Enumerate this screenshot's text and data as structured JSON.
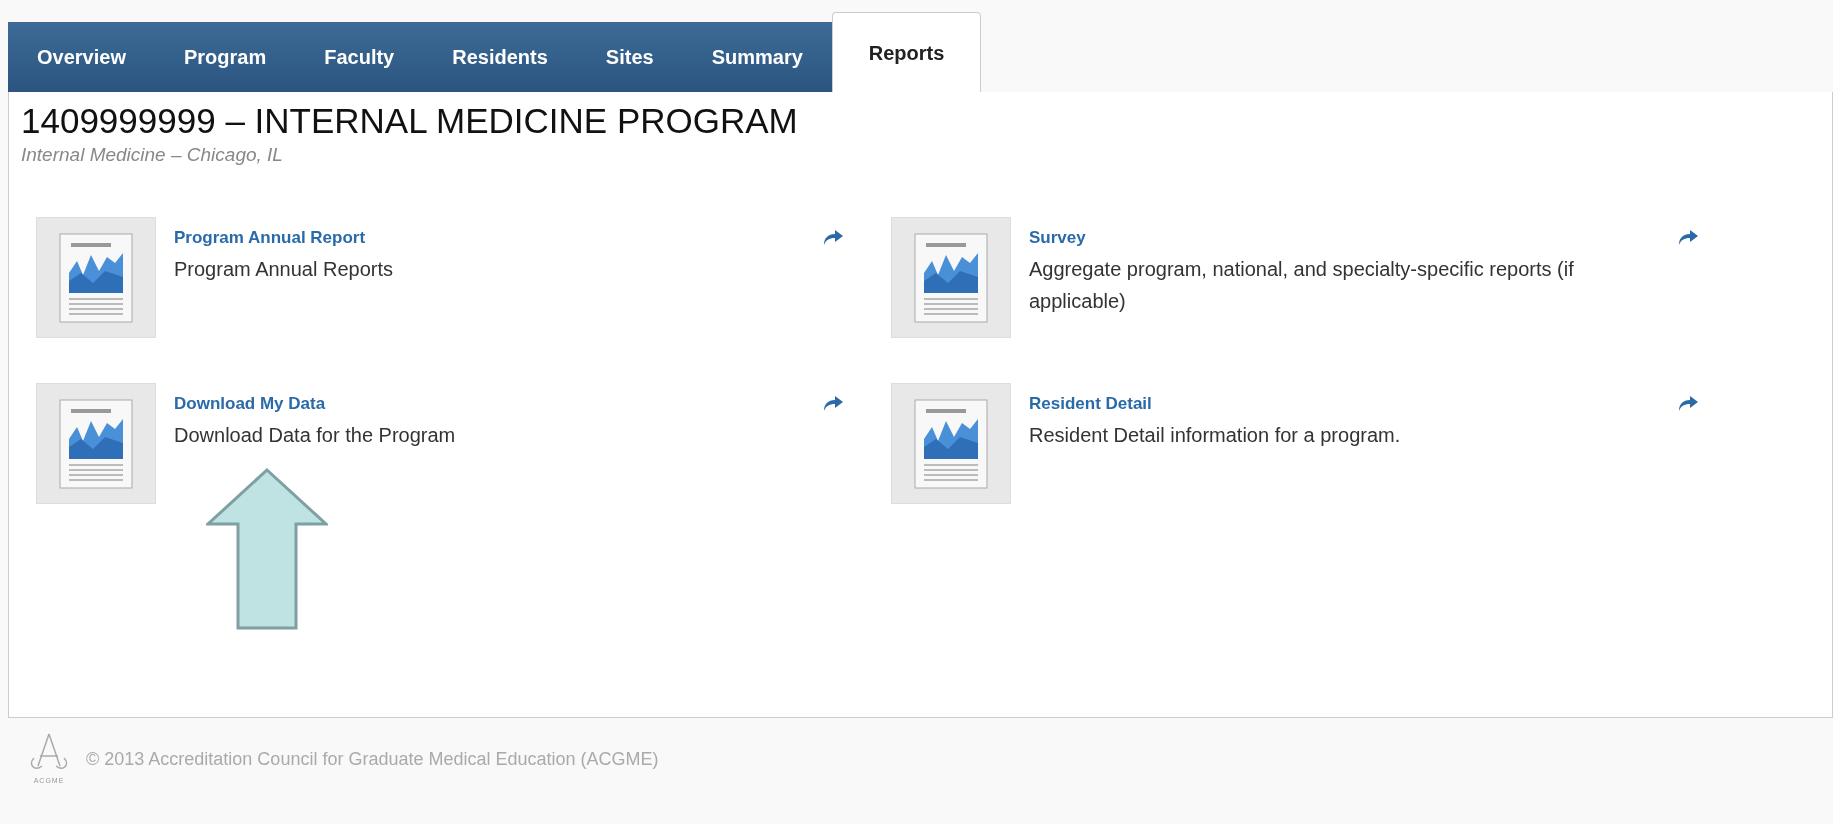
{
  "tabs": [
    {
      "label": "Overview",
      "selected": false
    },
    {
      "label": "Program",
      "selected": false
    },
    {
      "label": "Faculty",
      "selected": false
    },
    {
      "label": "Residents",
      "selected": false
    },
    {
      "label": "Sites",
      "selected": false
    },
    {
      "label": "Summary",
      "selected": false
    },
    {
      "label": "Reports",
      "selected": true
    }
  ],
  "program": {
    "title": "1409999999 – INTERNAL MEDICINE PROGRAM",
    "subtitle": "Internal Medicine – Chicago, IL"
  },
  "reports": [
    {
      "title": "Program Annual Report",
      "description": "Program Annual Reports"
    },
    {
      "title": "Survey",
      "description": "Aggregate program, national, and specialty-specific reports (if applicable)"
    },
    {
      "title": "Download My Data",
      "description": "Download Data for the Program",
      "callout": true
    },
    {
      "title": "Resident Detail",
      "description": "Resident Detail information for a program."
    }
  ],
  "footer": {
    "logo_text": "ACGME",
    "copyright": "© 2013 Accreditation Council for Graduate Medical Education (ACGME)"
  }
}
